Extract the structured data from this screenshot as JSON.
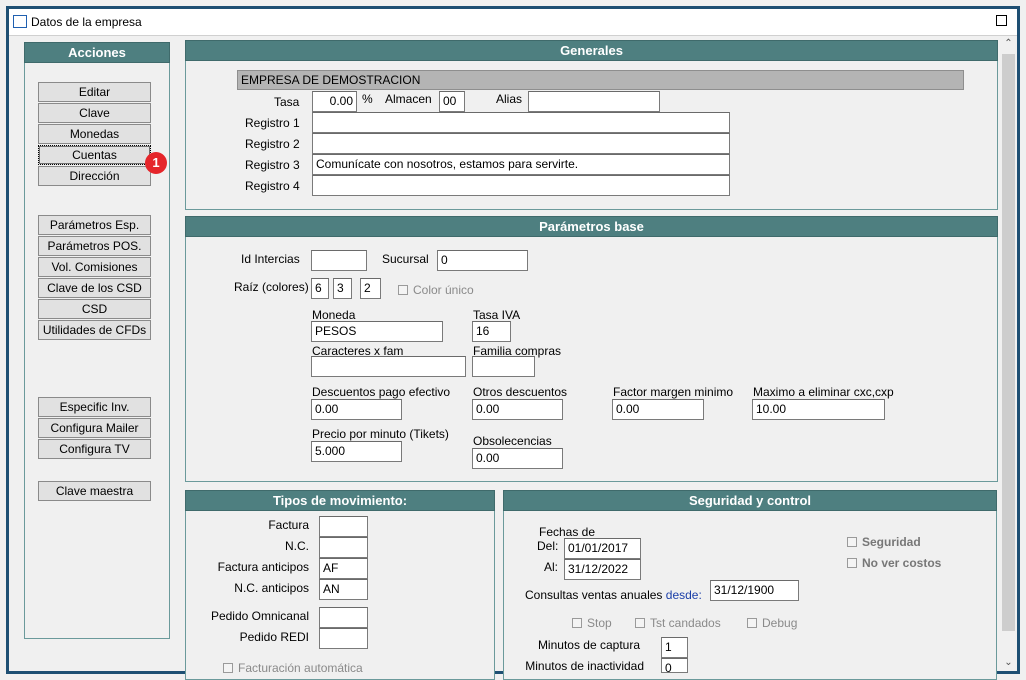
{
  "window": {
    "title": "Datos de la empresa"
  },
  "acciones": {
    "title": "Acciones",
    "group1": [
      "Editar",
      "Clave",
      "Monedas",
      "Cuentas",
      "Dirección"
    ],
    "group2": [
      "Parámetros Esp.",
      "Parámetros POS.",
      "Vol. Comisiones",
      "Clave de los CSD",
      "CSD",
      "Utilidades de CFDs"
    ],
    "group3": [
      "Especific Inv.",
      "Configura Mailer",
      "Configura TV"
    ],
    "group4": [
      "Clave maestra"
    ],
    "badge": "1"
  },
  "generales": {
    "title": "Generales",
    "company_name": "EMPRESA DE DEMOSTRACION",
    "tasa_label": "Tasa",
    "tasa_value": "0.00",
    "percent": "%",
    "almacen_label": "Almacen",
    "almacen_value": "00",
    "alias_label": "Alias",
    "alias_value": "",
    "registro1_label": "Registro 1",
    "registro1_value": "",
    "registro2_label": "Registro 2",
    "registro2_value": "",
    "registro3_label": "Registro 3",
    "registro3_value": "Comunícate con nosotros, estamos para servirte.",
    "registro4_label": "Registro 4",
    "registro4_value": ""
  },
  "parametros": {
    "title": "Parámetros base",
    "id_intercias_label": "Id Intercias",
    "id_intercias_value": "",
    "sucursal_label": "Sucursal",
    "sucursal_value": "0",
    "raiz_label": "Raíz (colores)",
    "raiz_values": [
      "6",
      "3",
      "2"
    ],
    "color_unico_label": "Color único",
    "moneda_label": "Moneda",
    "moneda_value": "PESOS",
    "tasa_iva_label": "Tasa IVA",
    "tasa_iva_value": "16",
    "caracteres_label": "Caracteres x fam",
    "caracteres_value": "",
    "familia_label": "Familia compras",
    "familia_value": "",
    "desc_pago_label": "Descuentos pago efectivo",
    "desc_pago_value": "0.00",
    "otros_desc_label": "Otros descuentos",
    "otros_desc_value": "0.00",
    "factor_label": "Factor margen minimo",
    "factor_value": "0.00",
    "maximo_label": "Maximo a eliminar cxc,cxp",
    "maximo_value": "10.00",
    "precio_min_label": "Precio por minuto (Tikets)",
    "precio_min_value": "5.000",
    "obsolescencias_label": "Obsolecencias",
    "obsolescencias_value": "0.00"
  },
  "tipos": {
    "title": "Tipos de movimiento:",
    "factura_label": "Factura",
    "factura_value": "",
    "nc_label": "N.C.",
    "nc_value": "",
    "factura_ant_label": "Factura anticipos",
    "factura_ant_value": "AF",
    "nc_ant_label": "N.C. anticipos",
    "nc_ant_value": "AN",
    "pedido_omni_label": "Pedido Omnicanal",
    "pedido_omni_value": "",
    "pedido_redi_label": "Pedido REDI",
    "pedido_redi_value": "",
    "fact_auto_label": "Facturación automática"
  },
  "seguridad": {
    "title": "Seguridad y control",
    "fechas_label": "Fechas de",
    "del_label": "Del:",
    "del_value": "01/01/2017",
    "al_label": "Al:",
    "al_value": "31/12/2022",
    "consultas_label": "Consultas ventas anuales",
    "desde_label": "desde:",
    "desde_value": "31/12/1900",
    "seguridad_label": "Seguridad",
    "no_ver_costos_label": "No ver costos",
    "stop_label": "Stop",
    "tst_label": "Tst candados",
    "debug_label": "Debug",
    "min_captura_label": "Minutos de captura",
    "min_captura_value": "1",
    "min_inact_label": "Minutos de inactividad",
    "min_inact_value": "0"
  }
}
